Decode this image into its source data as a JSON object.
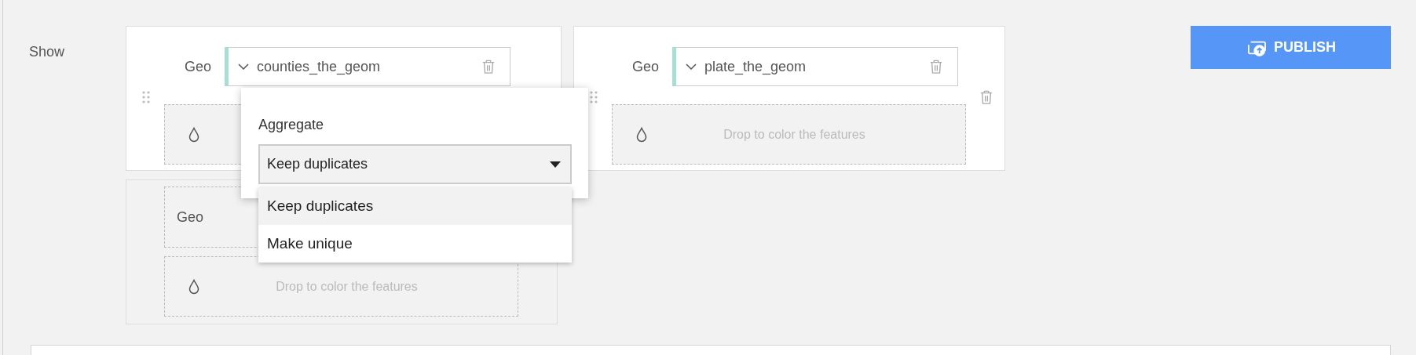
{
  "section_label": "Show",
  "layers": [
    {
      "kind": "filled",
      "geo_label": "Geo",
      "geo_column": "counties_the_geom",
      "hovered": false
    },
    {
      "kind": "filled",
      "geo_label": "Geo",
      "geo_column": "plate_the_geom",
      "color_hint": "Drop to color the features",
      "hovered": true
    },
    {
      "kind": "empty",
      "geo_label": "Geo",
      "color_hint": "Drop to color the features"
    }
  ],
  "aggregate_popup": {
    "title": "Aggregate",
    "value": "Keep duplicates",
    "options": [
      {
        "label": "Keep duplicates",
        "selected": true
      },
      {
        "label": "Make unique",
        "selected": false
      }
    ]
  },
  "publish_button": {
    "label": "PUBLISH"
  }
}
